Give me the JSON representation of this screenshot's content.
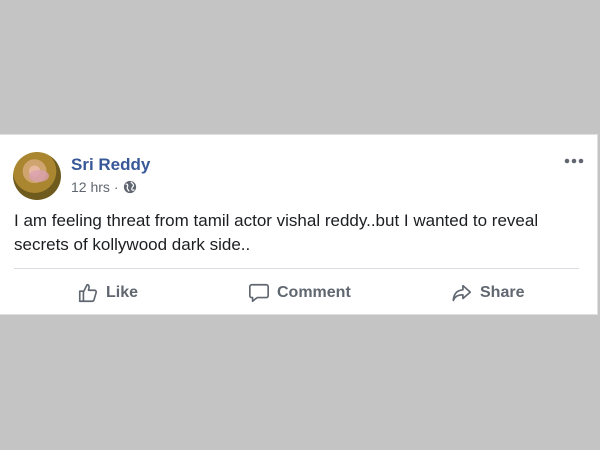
{
  "post": {
    "author": "Sri Reddy",
    "timestamp": "12 hrs",
    "separator": "·",
    "privacy_icon": "globe-icon",
    "text": "I am feeling threat from tamil actor vishal reddy..but I wanted to reveal secrets of kollywood dark side..",
    "more_icon": "more-options-icon"
  },
  "actions": {
    "like": "Like",
    "comment": "Comment",
    "share": "Share"
  },
  "colors": {
    "author_name": "#385898",
    "action_text": "#606770",
    "background": "#c4c4c4"
  }
}
